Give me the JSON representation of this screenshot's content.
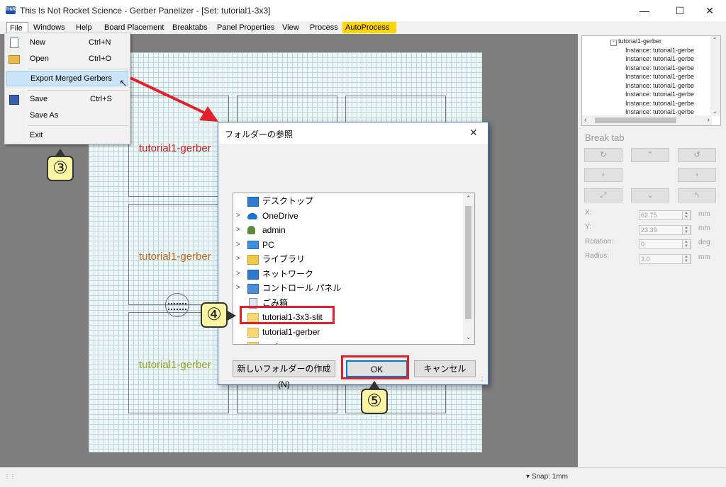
{
  "window": {
    "icon_text": "TINRS",
    "title": "This Is Not Rocket Science - Gerber Panelizer - [Set: tutorial1-3x3]",
    "minimize_icon": "minimize-icon",
    "maximize_icon": "maximize-icon",
    "close_icon": "close-icon"
  },
  "menubar": {
    "items": [
      "File",
      "Windows",
      "Help",
      "Board Placement",
      "Breaktabs",
      "Panel Properties",
      "View",
      "Process",
      "AutoProcess"
    ],
    "autoprocess_color": "#ffd500"
  },
  "file_menu": {
    "new": {
      "label": "New",
      "shortcut": "Ctrl+N",
      "icon": "new-file-icon"
    },
    "open": {
      "label": "Open",
      "shortcut": "Ctrl+O",
      "icon": "open-folder-icon"
    },
    "export": {
      "label": "Export Merged Gerbers"
    },
    "save": {
      "label": "Save",
      "shortcut": "Ctrl+S",
      "icon": "save-icon"
    },
    "save_as": {
      "label": "Save As"
    },
    "exit": {
      "label": "Exit"
    }
  },
  "canvas": {
    "board_labels": [
      "tutorial1-gerber",
      "tutorial1-gerber",
      "tutorial1-gerber"
    ],
    "board_label_colors": [
      "#c8201e",
      "#c8661e",
      "#9aa322"
    ]
  },
  "tree": {
    "root": "tutorial1-gerber",
    "instances": [
      "Instance: tutorial1-gerbe",
      "Instance: tutorial1-gerbe",
      "Instance: tutorial1-gerbe",
      "Instance: tutorial1-gerbe",
      "Instance: tutorial1-gerbe",
      "Instance: tutorial1-gerbe",
      "Instance: tutorial1-gerbe",
      "Instance: tutorial1-gerbe",
      "Instance: tutorial1-gerbe"
    ]
  },
  "break_tab": {
    "title": "Break tab",
    "x_label": "X:",
    "x_value": "62.75",
    "x_unit": "mm",
    "y_label": "Y:",
    "y_value": "23.39",
    "y_unit": "mm",
    "rotation_label": "Rotation:",
    "rotation_value": "0",
    "rotation_unit": "deg",
    "radius_label": "Radius:",
    "radius_value": "3.0",
    "radius_unit": "mm"
  },
  "statusbar": {
    "snap": "Snap: 1mm"
  },
  "dialog": {
    "title": "フォルダーの参照",
    "folders": [
      {
        "label": "デスクトップ",
        "icon": "desktop-icon",
        "chevron": ""
      },
      {
        "label": "OneDrive",
        "icon": "onedrive-cloud-icon",
        "chevron": ">"
      },
      {
        "label": "admin",
        "icon": "user-icon",
        "chevron": ">"
      },
      {
        "label": "PC",
        "icon": "pc-icon",
        "chevron": ">"
      },
      {
        "label": "ライブラリ",
        "icon": "library-icon",
        "chevron": ">"
      },
      {
        "label": "ネットワーク",
        "icon": "network-icon",
        "chevron": ">"
      },
      {
        "label": "コントロール パネル",
        "icon": "control-panel-icon",
        "chevron": ">"
      },
      {
        "label": "ごみ箱",
        "icon": "recycle-bin-icon",
        "chevron": ""
      },
      {
        "label": "tutorial1-3x3-slit",
        "icon": "folder-icon",
        "chevron": ""
      },
      {
        "label": "tutorial1-gerber",
        "icon": "folder-icon",
        "chevron": ""
      },
      {
        "label": "work",
        "icon": "folder-icon",
        "chevron": ""
      }
    ],
    "new_folder_button": "新しいフォルダーの作成(N)",
    "ok_button": "OK",
    "cancel_button": "キャンセル"
  },
  "callouts": {
    "step3": "③",
    "step4": "④",
    "step5": "⑤",
    "highlight_color": "#e0202a",
    "arrow_color": "#e0202a"
  }
}
